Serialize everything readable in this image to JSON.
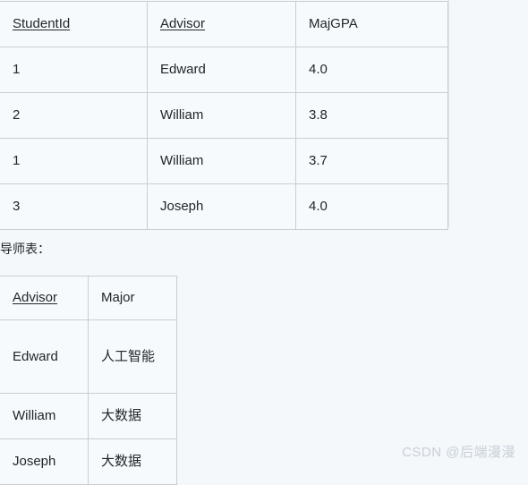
{
  "page": {
    "background_color": "#f4f8fb",
    "text_color": "#1f2329",
    "border_color": "#c9ced4"
  },
  "student_table": {
    "name": "student-relation-table",
    "columns": [
      {
        "label": "StudentId",
        "is_key": true
      },
      {
        "label": "Advisor",
        "is_key": true
      },
      {
        "label": "MajGPA",
        "is_key": false
      }
    ],
    "rows": [
      {
        "student_id": "1",
        "advisor": "Edward",
        "maj_gpa": "4.0"
      },
      {
        "student_id": "2",
        "advisor": "William",
        "maj_gpa": "3.8"
      },
      {
        "student_id": "1",
        "advisor": "William",
        "maj_gpa": "3.7"
      },
      {
        "student_id": "3",
        "advisor": "Joseph",
        "maj_gpa": "4.0"
      }
    ]
  },
  "advisor_caption": "导师表：",
  "advisor_table": {
    "name": "advisor-relation-table",
    "columns": [
      {
        "label": "Advisor",
        "is_key": true
      },
      {
        "label": "Major",
        "is_key": false
      }
    ],
    "rows": [
      {
        "advisor": "Edward",
        "major": "人工智能"
      },
      {
        "advisor": "William",
        "major": "大数据"
      },
      {
        "advisor": "Joseph",
        "major": "大数据"
      }
    ]
  },
  "watermark": {
    "text": "CSDN @后端漫漫",
    "color": "#c8cfd8"
  }
}
